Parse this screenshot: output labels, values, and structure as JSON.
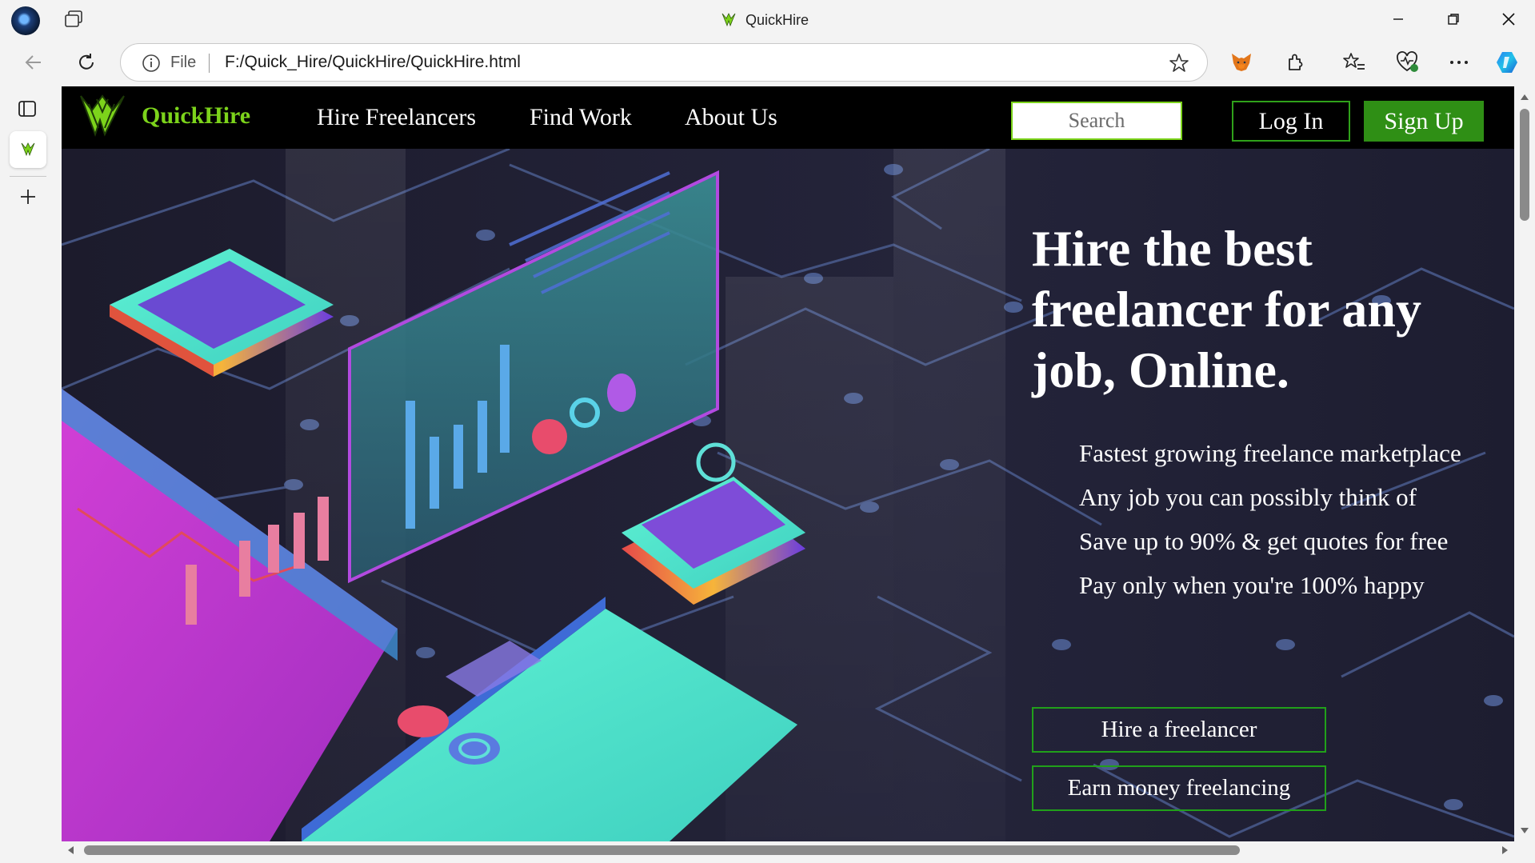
{
  "browser": {
    "window_title": "QuickHire",
    "address": {
      "scheme_label": "File",
      "url": "F:/Quick_Hire/QuickHire/QuickHire.html"
    },
    "icons": [
      "profile-avatar",
      "tab-actions-icon",
      "back-arrow-icon",
      "refresh-icon",
      "info-icon",
      "star-icon",
      "metamask-fox-icon",
      "extensions-icon",
      "favorites-icon",
      "browser-essentials-icon",
      "more-icon",
      "copilot-icon",
      "minimize-icon",
      "restore-icon",
      "close-icon",
      "sidebar-toggle-icon",
      "new-tab-plus-icon"
    ]
  },
  "site": {
    "brand": "QuickHire",
    "nav": [
      {
        "label": "Hire Freelancers"
      },
      {
        "label": "Find Work"
      },
      {
        "label": "About Us"
      }
    ],
    "search_placeholder": "Search",
    "login_label": "Log In",
    "signup_label": "Sign Up",
    "colors": {
      "brand_green": "#7cd31b",
      "signup_green": "#2f8f15",
      "outline_green": "#21a01a"
    }
  },
  "hero": {
    "headline": "Hire the best freelancer for any job, Online.",
    "features": [
      "Fastest growing freelance marketplace",
      "Any job you can possibly think of",
      "Save up to 90% & get quotes for free",
      "Pay only when you're 100% happy"
    ],
    "cta_hire": "Hire a freelancer",
    "cta_earn": "Earn money freelancing"
  }
}
